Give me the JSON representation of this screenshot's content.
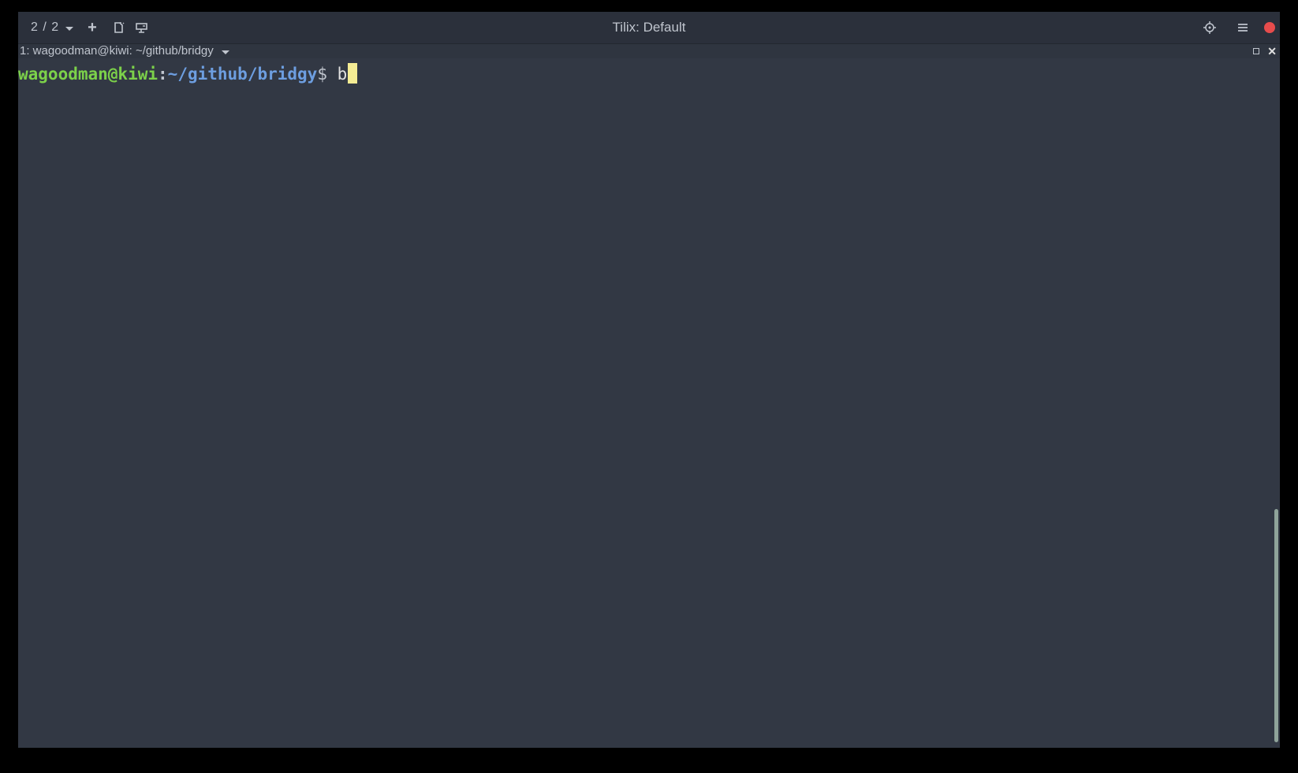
{
  "window": {
    "title": "Tilix: Default"
  },
  "headerbar": {
    "session_switcher_label": "2 / 2",
    "add_button_label": "+"
  },
  "terminal": {
    "tab_title": "1: wagoodman@kiwi: ~/github/bridgy",
    "prompt_user_host": "wagoodman@kiwi",
    "prompt_colon": ":",
    "prompt_path": "~/github/bridgy",
    "prompt_symbol": "$",
    "input_text": "b"
  },
  "colors": {
    "close_button": "#e74c4c",
    "prompt_user": "#7cd14a",
    "prompt_path": "#6d9ee0",
    "cursor": "#f4ec94",
    "background": "#323844"
  }
}
